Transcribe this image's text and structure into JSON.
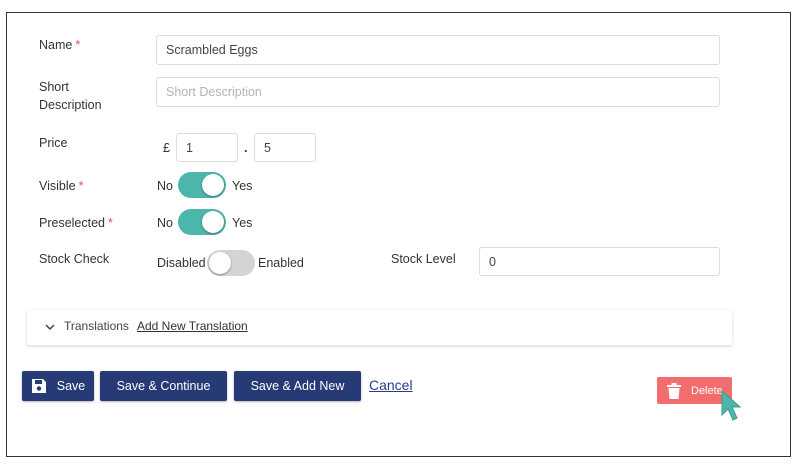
{
  "form": {
    "name": {
      "label": "Name",
      "required_mark": "*",
      "value": "Scrambled Eggs"
    },
    "short_description": {
      "label_line1": "Short",
      "label_line2": "Description",
      "placeholder": "Short Description",
      "value": ""
    },
    "price": {
      "label": "Price",
      "currency_symbol": "£",
      "whole_value": "1",
      "separator": ".",
      "fraction_value": "5"
    },
    "visible": {
      "label": "Visible",
      "required_mark": "*",
      "off_label": "No",
      "on_label": "Yes",
      "state": "on"
    },
    "preselected": {
      "label": "Preselected",
      "required_mark": "*",
      "off_label": "No",
      "on_label": "Yes",
      "state": "on"
    },
    "stock_check": {
      "label": "Stock Check",
      "off_label": "Disabled",
      "on_label": "Enabled",
      "state": "off"
    },
    "stock_level": {
      "label": "Stock Level",
      "value": "0"
    }
  },
  "translations": {
    "label": "Translations",
    "add_link": "Add New Translation",
    "icon": "chevron-down-icon"
  },
  "actions": {
    "save_label": "Save",
    "save_icon": "floppy-disk-icon",
    "save_continue_label": "Save & Continue",
    "save_add_new_label": "Save & Add New",
    "cancel_label": "Cancel",
    "delete_label": "Delete",
    "delete_icon": "trash-icon"
  },
  "colors": {
    "primary": "#263a75",
    "toggle_on": "#4db6ac",
    "toggle_off": "#d4d4d4",
    "danger": "#f26d6d",
    "required": "#d9534f",
    "cursor": "#4db6ac"
  }
}
